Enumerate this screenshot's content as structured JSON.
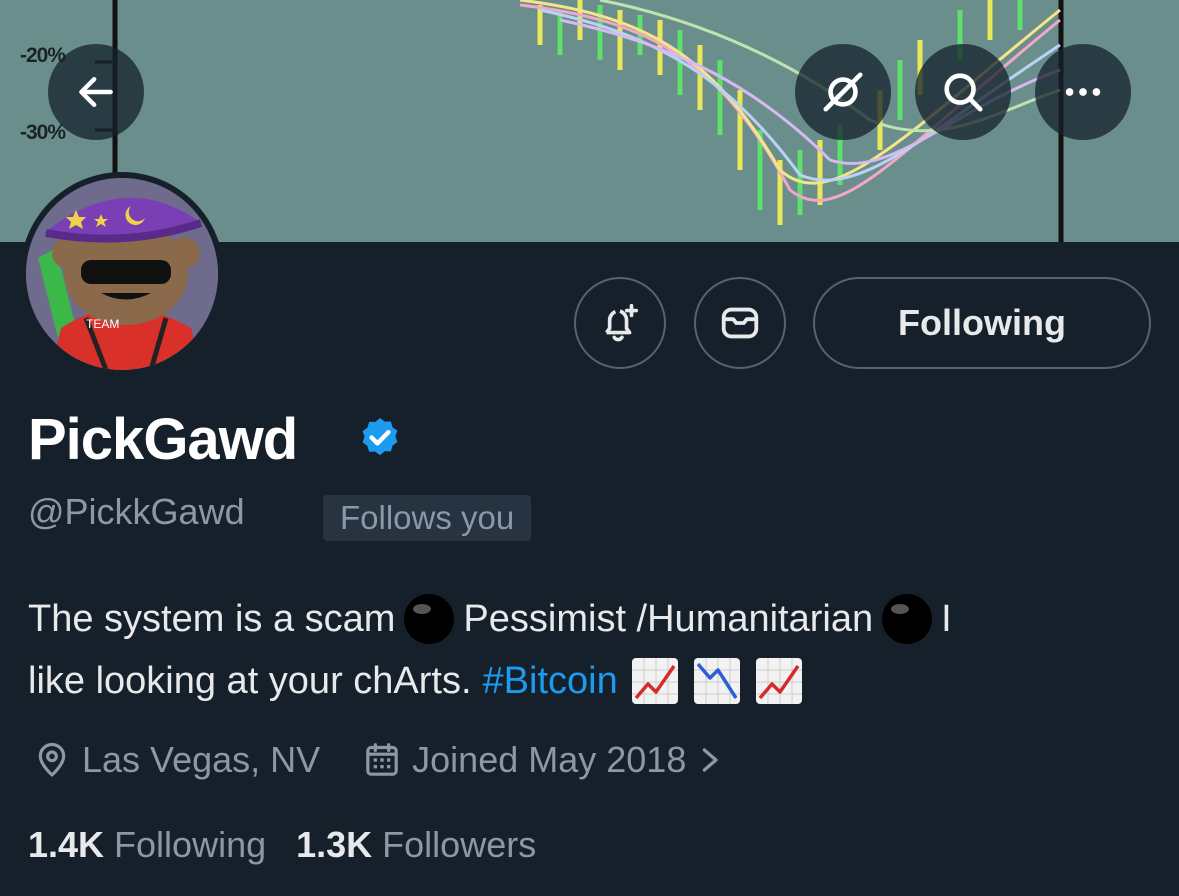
{
  "banner": {
    "tick_labels": [
      "-20%",
      "-30%"
    ]
  },
  "top_nav": {
    "back_icon": "arrow-left-icon",
    "grok_icon": "grok-slash-icon",
    "search_icon": "search-icon",
    "more_icon": "more-icon"
  },
  "actions": {
    "notify_icon": "bell-plus-icon",
    "message_icon": "envelope-icon",
    "following_label": "Following"
  },
  "profile": {
    "display_name": "PickGawd",
    "handle": "@PickkGawd",
    "follows_you_label": "Follows you",
    "bio": {
      "line1_part1": "The system is a scam",
      "line1_part2": "Pessimist /Humanitarian",
      "line1_part3": "I",
      "line2_text": "like looking at your chArts.",
      "hashtag": "#Bitcoin"
    },
    "location": "Las Vegas, NV",
    "joined": "Joined May 2018",
    "following_count": "1.4K",
    "following_label": "Following",
    "followers_count": "1.3K",
    "followers_label": "Followers"
  },
  "colors": {
    "background": "#15202b",
    "accent": "#1d9bf0",
    "secondary_text": "#8b98a5",
    "verified": "#1d9bf0"
  }
}
